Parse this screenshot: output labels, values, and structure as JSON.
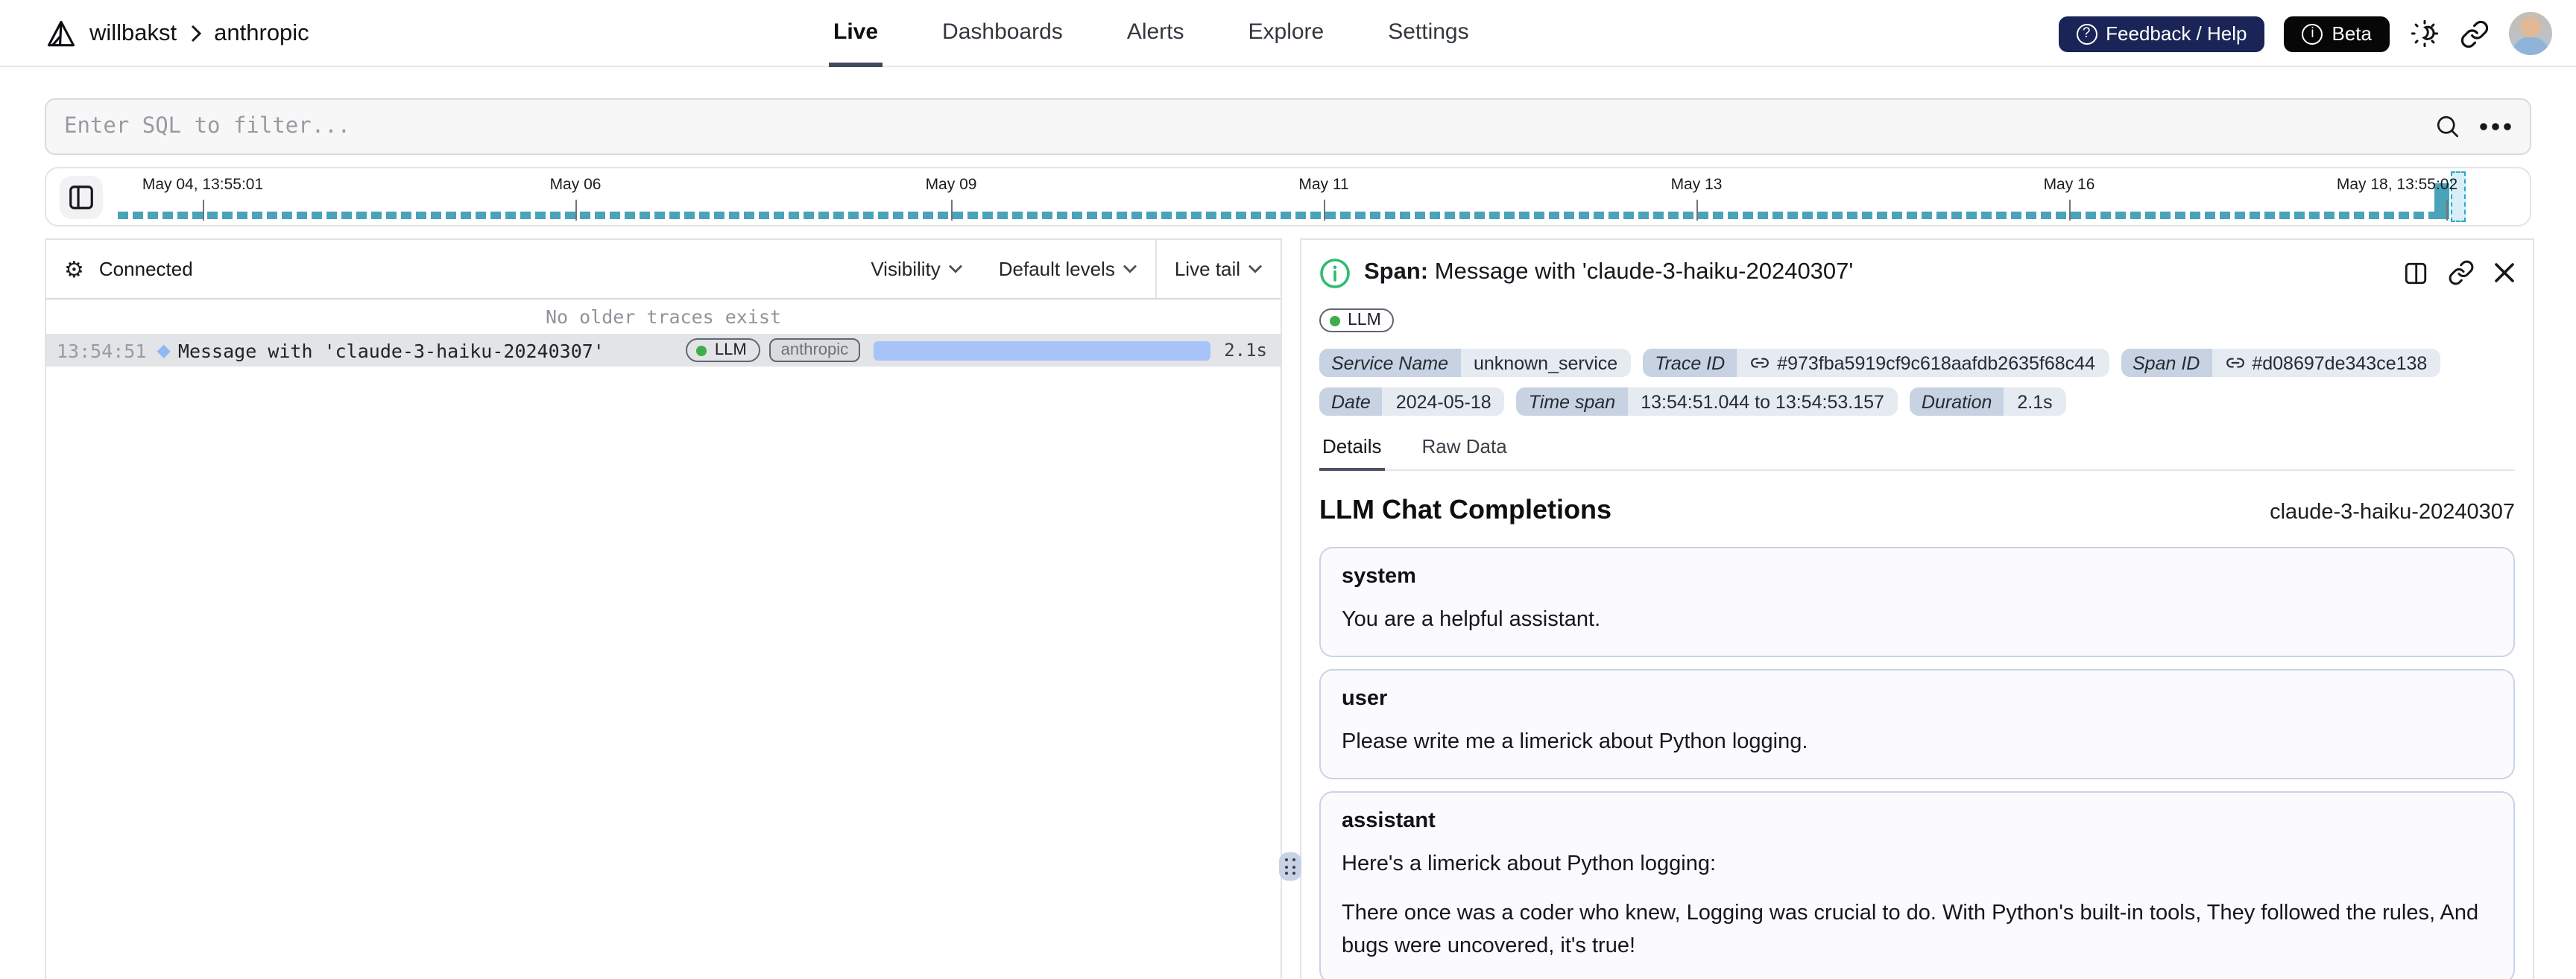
{
  "header": {
    "breadcrumb": {
      "org": "willbakst",
      "project": "anthropic"
    },
    "nav": [
      {
        "label": "Live"
      },
      {
        "label": "Dashboards"
      },
      {
        "label": "Alerts"
      },
      {
        "label": "Explore"
      },
      {
        "label": "Settings"
      }
    ],
    "feedback_label": "Feedback / Help",
    "beta_label": "Beta"
  },
  "filter": {
    "placeholder": "Enter SQL to filter..."
  },
  "timeline": {
    "labels": [
      "May 04, 13:55:01",
      "May 06",
      "May 09",
      "May 11",
      "May 13",
      "May 16",
      "May 18, 13:55:02"
    ]
  },
  "left_panel": {
    "status": "Connected",
    "visibility_label": "Visibility",
    "default_levels_label": "Default levels",
    "live_tail_label": "Live tail",
    "empty_message": "No older traces exist",
    "trace": {
      "time": "13:54:51",
      "message": "Message with 'claude-3-haiku-20240307'",
      "tag_llm": "LLM",
      "tag_service": "anthropic",
      "duration": "2.1s"
    }
  },
  "span_panel": {
    "label": "Span:",
    "title": "Message with 'claude-3-haiku-20240307'",
    "tag": "LLM",
    "meta1": [
      {
        "key": "Service Name",
        "value": "unknown_service"
      },
      {
        "key": "Trace ID",
        "value": "#973fba5919cf9c618aafdb2635f68c44"
      },
      {
        "key": "Span ID",
        "value": "#d08697de343ce138"
      }
    ],
    "meta2": [
      {
        "key": "Date",
        "value": "2024-05-18"
      },
      {
        "key": "Time span",
        "value": "13:54:51.044 to 13:54:53.157"
      },
      {
        "key": "Duration",
        "value": "2.1s"
      }
    ],
    "tabs": [
      {
        "label": "Details"
      },
      {
        "label": "Raw Data"
      }
    ],
    "section_title": "LLM Chat Completions",
    "model": "claude-3-haiku-20240307",
    "messages": {
      "system": {
        "role": "system",
        "text": "You are a helpful assistant."
      },
      "user": {
        "role": "user",
        "text": "Please write me a limerick about Python logging."
      },
      "assistant": {
        "role": "assistant",
        "intro": "Here's a limerick about Python logging:",
        "text": "There once was a coder who knew, Logging was crucial to do. With Python's built-in tools, They followed the rules, And bugs were uncovered, it's true!"
      }
    }
  }
}
